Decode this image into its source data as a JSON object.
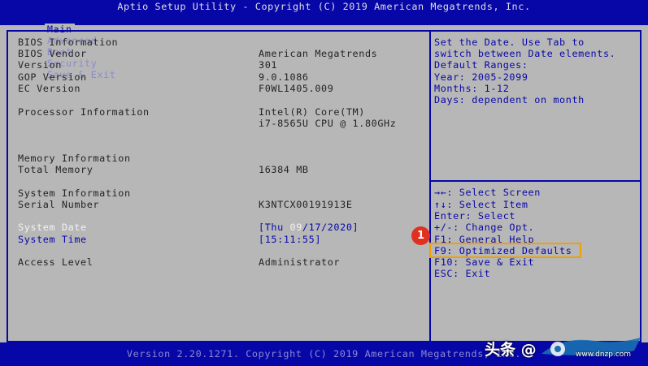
{
  "header": {
    "title": "Aptio Setup Utility - Copyright (C) 2019 American Megatrends, Inc.",
    "tabs": [
      "Main",
      "Advanced",
      "Boot",
      "Security",
      "Save & Exit"
    ],
    "active_tab": "Main"
  },
  "main": {
    "rows": [
      {
        "label": "BIOS Information",
        "value": ""
      },
      {
        "label": "BIOS Vendor",
        "value": "American Megatrends"
      },
      {
        "label": "Version",
        "value": "301"
      },
      {
        "label": "GOP Version",
        "value": "9.0.1086"
      },
      {
        "label": "EC Version",
        "value": "F0WL1405.009"
      },
      {
        "label": "Processor Information",
        "value": "Intel(R) Core(TM)"
      },
      {
        "label": "",
        "value": "i7-8565U CPU @ 1.80GHz"
      },
      {
        "label": "Memory Information",
        "value": ""
      },
      {
        "label": "Total Memory",
        "value": "16384 MB"
      },
      {
        "label": "System Information",
        "value": ""
      },
      {
        "label": "Serial Number",
        "value": "K3NTCX00191913E"
      },
      {
        "label": "System Date",
        "value": "[Thu 09/17/2020]"
      },
      {
        "label": "System Time",
        "value": "[15:11:55]"
      },
      {
        "label": "Access Level",
        "value": "Administrator"
      }
    ],
    "date_parts": {
      "pre": "[Thu ",
      "highlight": "09",
      "post": "/17/2020]"
    }
  },
  "help": {
    "lines": [
      "Set the Date. Use Tab to",
      "switch between Date elements.",
      "Default Ranges:",
      "Year: 2005-2099",
      "Months: 1-12",
      "Days: dependent on month"
    ],
    "keys": [
      "→←: Select Screen",
      "↑↓: Select Item",
      "Enter: Select",
      "+/-: Change Opt.",
      "F1: General Help",
      "F9: Optimized Defaults",
      "F10: Save & Exit",
      "ESC: Exit"
    ]
  },
  "annotation": {
    "marker": "1"
  },
  "footer": {
    "text": "Version 2.20.1271. Copyright (C) 2019 American Megatrends, Inc."
  },
  "watermark": {
    "text": "头条 @",
    "site": "www.dnzp.com"
  },
  "colors": {
    "bios_blue": "#0707A8",
    "panel_gray": "#B7B7B7",
    "highlight_white": "#F2F2F2",
    "annotation_orange": "#F0A000",
    "marker_red": "#E03020"
  }
}
